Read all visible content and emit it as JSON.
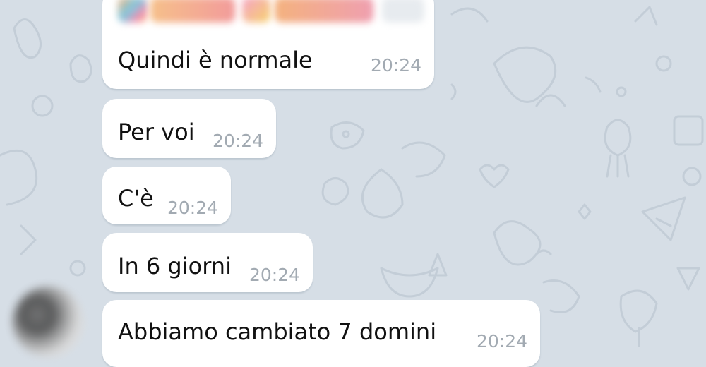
{
  "chat": {
    "messages": [
      {
        "text": "Quindi è normale",
        "time": "20:24"
      },
      {
        "text": "Per voi",
        "time": "20:24"
      },
      {
        "text": "C'è",
        "time": "20:24"
      },
      {
        "text": "In 6 giorni",
        "time": "20:24"
      },
      {
        "text": "Abbiamo cambiato 7 domini",
        "time": "20:24"
      }
    ]
  },
  "colors": {
    "background": "#d6dee6",
    "bubble": "#ffffff",
    "text": "#111111",
    "timestamp": "#a2aab2"
  }
}
